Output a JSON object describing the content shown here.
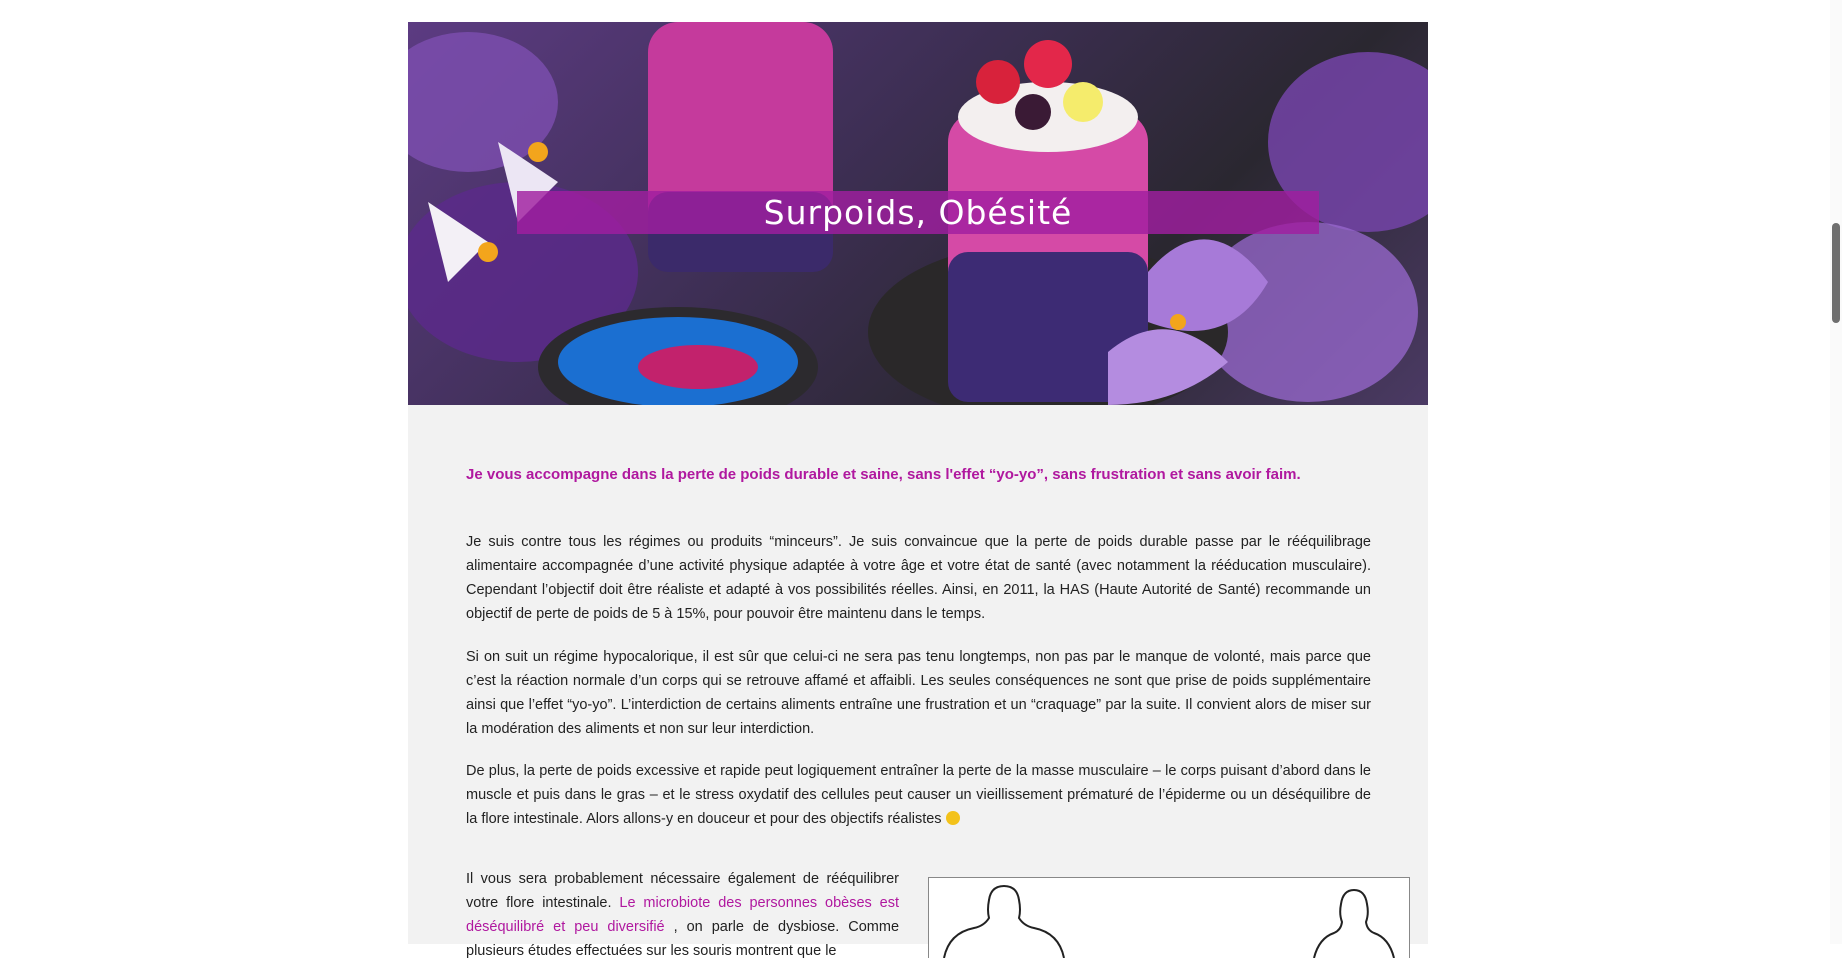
{
  "hero": {
    "title": "Surpoids, Obésité"
  },
  "lead": "Je vous accompagne dans la perte de poids durable et saine, sans l'effet “yo-yo”, sans frustration et sans avoir faim.",
  "paragraphs": [
    "Je suis contre tous les régimes ou produits “minceurs”. Je suis convaincue que la perte de poids durable passe par le rééquilibrage alimentaire accompagnée d’une activité physique adaptée à votre âge et votre état de santé (avec notamment la rééducation musculaire). Cependant l’objectif doit être réaliste et adapté à vos possibilités réelles. Ainsi, en 2011, la HAS (Haute Autorité de Santé) recommande un objectif de perte de poids de 5 à 15%, pour pouvoir être maintenu dans le temps.",
    "Si on suit un régime hypocalorique, il est sûr que celui-ci ne sera pas tenu longtemps, non pas par le manque de volonté, mais parce que c’est la réaction normale d’un corps qui se retrouve affamé et affaibli. Les seules conséquences ne sont que prise de poids supplémentaire ainsi que l’effet “yo-yo”. L’interdiction de certains aliments entraîne une frustration et un “craquage” par la suite. Il convient alors de miser sur la modération des aliments et non sur leur interdiction.",
    "De plus, la perte de poids excessive et rapide peut logiquement entraîner la perte de la masse musculaire – le corps puisant d’abord dans le muscle et puis dans le gras – et le stress oxydatif des cellules peut causer un vieillissement prématuré de l’épiderme ou un déséquilibre de la flore intestinale. Alors allons-y en douceur et pour des objectifs réalistes"
  ],
  "p4": {
    "before": "Il vous sera probablement nécessaire également de rééquilibrer votre flore intestinale.",
    "link": "Le microbiote des personnes obèses est déséquilibré et peu diversifié",
    "after": ", on parle de dysbiose. Comme plusieurs études effectuées sur les souris montrent que le"
  },
  "colors": {
    "accent": "#b0189f",
    "title_band": "#a01ea0"
  },
  "icons": {
    "emoji": "winking-face-icon"
  }
}
